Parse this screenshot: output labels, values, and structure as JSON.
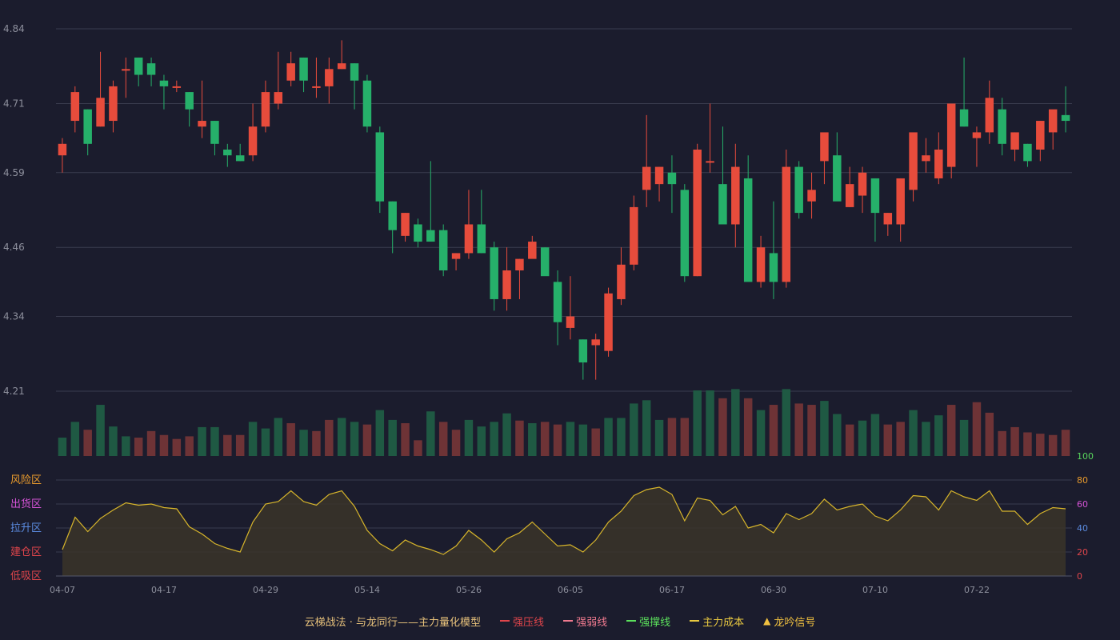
{
  "chart_data": {
    "type": "candlestick",
    "price_axis": {
      "ticks": [
        "4.84",
        "4.71",
        "4.59",
        "4.46",
        "4.34",
        "4.21"
      ],
      "range": [
        4.21,
        4.84
      ]
    },
    "date_ticks": [
      "04-07",
      "04-17",
      "04-29",
      "05-14",
      "05-26",
      "06-05",
      "06-17",
      "06-30",
      "07-10",
      "07-22"
    ],
    "candles": [
      [
        4.62,
        4.65,
        4.59,
        4.64
      ],
      [
        4.68,
        4.74,
        4.66,
        4.73
      ],
      [
        4.7,
        4.7,
        4.62,
        4.64
      ],
      [
        4.67,
        4.8,
        4.67,
        4.72
      ],
      [
        4.68,
        4.75,
        4.66,
        4.74
      ],
      [
        4.77,
        4.79,
        4.72,
        4.77
      ],
      [
        4.79,
        4.79,
        4.74,
        4.76
      ],
      [
        4.78,
        4.79,
        4.74,
        4.76
      ],
      [
        4.75,
        4.76,
        4.7,
        4.74
      ],
      [
        4.74,
        4.75,
        4.73,
        4.74
      ],
      [
        4.73,
        4.73,
        4.67,
        4.7
      ],
      [
        4.67,
        4.75,
        4.65,
        4.68
      ],
      [
        4.68,
        4.68,
        4.62,
        4.64
      ],
      [
        4.63,
        4.64,
        4.6,
        4.62
      ],
      [
        4.62,
        4.64,
        4.61,
        4.61
      ],
      [
        4.62,
        4.71,
        4.61,
        4.67
      ],
      [
        4.67,
        4.75,
        4.66,
        4.73
      ],
      [
        4.71,
        4.8,
        4.7,
        4.73
      ],
      [
        4.75,
        4.8,
        4.74,
        4.78
      ],
      [
        4.79,
        4.79,
        4.73,
        4.75
      ],
      [
        4.74,
        4.79,
        4.72,
        4.74
      ],
      [
        4.74,
        4.79,
        4.71,
        4.77
      ],
      [
        4.77,
        4.82,
        4.77,
        4.78
      ],
      [
        4.78,
        4.78,
        4.7,
        4.75
      ],
      [
        4.75,
        4.76,
        4.66,
        4.67
      ],
      [
        4.66,
        4.67,
        4.52,
        4.54
      ],
      [
        4.54,
        4.54,
        4.45,
        4.49
      ],
      [
        4.48,
        4.52,
        4.47,
        4.52
      ],
      [
        4.5,
        4.51,
        4.46,
        4.47
      ],
      [
        4.49,
        4.61,
        4.48,
        4.47
      ],
      [
        4.49,
        4.5,
        4.41,
        4.42
      ],
      [
        4.44,
        4.45,
        4.42,
        4.45
      ],
      [
        4.45,
        4.56,
        4.44,
        4.5
      ],
      [
        4.5,
        4.56,
        4.45,
        4.45
      ],
      [
        4.46,
        4.47,
        4.35,
        4.37
      ],
      [
        4.37,
        4.46,
        4.35,
        4.42
      ],
      [
        4.42,
        4.44,
        4.37,
        4.44
      ],
      [
        4.44,
        4.48,
        4.45,
        4.47
      ],
      [
        4.46,
        4.46,
        4.42,
        4.41
      ],
      [
        4.4,
        4.42,
        4.29,
        4.33
      ],
      [
        4.32,
        4.41,
        4.3,
        4.34
      ],
      [
        4.3,
        4.3,
        4.23,
        4.26
      ],
      [
        4.29,
        4.31,
        4.23,
        4.3
      ],
      [
        4.28,
        4.39,
        4.27,
        4.38
      ],
      [
        4.37,
        4.46,
        4.36,
        4.43
      ],
      [
        4.43,
        4.55,
        4.42,
        4.53
      ],
      [
        4.56,
        4.69,
        4.53,
        4.6
      ],
      [
        4.57,
        4.6,
        4.54,
        4.6
      ],
      [
        4.59,
        4.62,
        4.52,
        4.57
      ],
      [
        4.56,
        4.57,
        4.4,
        4.41
      ],
      [
        4.41,
        4.64,
        4.41,
        4.63
      ],
      [
        4.61,
        4.71,
        4.59,
        4.61
      ],
      [
        4.57,
        4.67,
        4.52,
        4.5
      ],
      [
        4.5,
        4.64,
        4.46,
        4.6
      ],
      [
        4.58,
        4.62,
        4.42,
        4.4
      ],
      [
        4.4,
        4.48,
        4.39,
        4.46
      ],
      [
        4.45,
        4.54,
        4.37,
        4.4
      ],
      [
        4.4,
        4.63,
        4.39,
        4.6
      ],
      [
        4.6,
        4.61,
        4.51,
        4.52
      ],
      [
        4.54,
        4.59,
        4.51,
        4.56
      ],
      [
        4.61,
        4.64,
        4.57,
        4.66
      ],
      [
        4.62,
        4.66,
        4.55,
        4.54
      ],
      [
        4.53,
        4.6,
        4.53,
        4.57
      ],
      [
        4.55,
        4.6,
        4.52,
        4.59
      ],
      [
        4.58,
        4.58,
        4.47,
        4.52
      ],
      [
        4.5,
        4.52,
        4.48,
        4.52
      ],
      [
        4.5,
        4.58,
        4.47,
        4.58
      ],
      [
        4.56,
        4.65,
        4.54,
        4.66
      ],
      [
        4.61,
        4.65,
        4.59,
        4.62
      ],
      [
        4.58,
        4.66,
        4.57,
        4.63
      ],
      [
        4.6,
        4.7,
        4.58,
        4.71
      ],
      [
        4.7,
        4.79,
        4.67,
        4.67
      ],
      [
        4.65,
        4.67,
        4.6,
        4.66
      ],
      [
        4.66,
        4.75,
        4.64,
        4.72
      ],
      [
        4.7,
        4.72,
        4.62,
        4.64
      ],
      [
        4.63,
        4.66,
        4.61,
        4.66
      ],
      [
        4.64,
        4.64,
        4.6,
        4.61
      ],
      [
        4.63,
        4.68,
        4.61,
        4.68
      ],
      [
        4.66,
        4.69,
        4.63,
        4.7
      ],
      [
        4.69,
        4.74,
        4.66,
        4.68
      ]
    ],
    "volume_levels": [
      28,
      52,
      40,
      78,
      45,
      30,
      28,
      38,
      32,
      26,
      30,
      44,
      44,
      32,
      32,
      52,
      42,
      58,
      50,
      40,
      38,
      55,
      58,
      52,
      48,
      70,
      55,
      50,
      24,
      68,
      52,
      40,
      55,
      45,
      52,
      65,
      54,
      50,
      52,
      48,
      52,
      48,
      42,
      58,
      58,
      80,
      85,
      55,
      58,
      58,
      100,
      100,
      88,
      102,
      88,
      70,
      78,
      102,
      80,
      78,
      84,
      64,
      48,
      54,
      64,
      48,
      52,
      70,
      52,
      62,
      78,
      55,
      82,
      66,
      38,
      44,
      36,
      34,
      32,
      40,
      44,
      40
    ],
    "volume_up": [
      false,
      false,
      true,
      false,
      false,
      false,
      true,
      true,
      true,
      true,
      true,
      false,
      false,
      true,
      true,
      false,
      false,
      false,
      true,
      false,
      true,
      true,
      false,
      false,
      true,
      false,
      false,
      true,
      true,
      false,
      true,
      true,
      false,
      false,
      false,
      false,
      true,
      false,
      true,
      true,
      false,
      false,
      true,
      false,
      false,
      false,
      false,
      false,
      true,
      true,
      false,
      false,
      true,
      false,
      true,
      false,
      true,
      false,
      true,
      true,
      false,
      false,
      true,
      false,
      false,
      true,
      true,
      false,
      false,
      false,
      true,
      false,
      true,
      true,
      true,
      true,
      true,
      true,
      true,
      true,
      true,
      true
    ],
    "indicator": {
      "zone_labels": [
        "风险区",
        "出货区",
        "拉升区",
        "建仓区",
        "低吸区"
      ],
      "zone_colors": [
        "#e89a2d",
        "#d553d6",
        "#5b8be0",
        "#e0454b",
        "#e0454b"
      ],
      "right_ticks": [
        "100",
        "80",
        "60",
        "40",
        "20",
        "0"
      ],
      "right_tick_colors": [
        "#58d65c",
        "#e89a2d",
        "#d553d6",
        "#5b8be0",
        "#e0454b",
        "#e0454b"
      ],
      "range": [
        0,
        100
      ],
      "values": [
        22,
        49,
        37,
        48,
        55,
        61,
        59,
        60,
        57,
        56,
        41,
        35,
        27,
        23,
        20,
        45,
        60,
        62,
        71,
        62,
        59,
        68,
        71,
        58,
        38,
        27,
        21,
        30,
        25,
        22,
        18,
        25,
        38,
        30,
        20,
        31,
        36,
        45,
        35,
        25,
        26,
        20,
        30,
        45,
        54,
        67,
        72,
        74,
        68,
        46,
        65,
        63,
        51,
        58,
        40,
        43,
        36,
        52,
        47,
        52,
        64,
        55,
        58,
        60,
        50,
        46,
        55,
        67,
        66,
        55,
        71,
        66,
        63,
        71,
        54,
        54,
        43,
        52,
        57,
        56
      ]
    },
    "legend": [
      {
        "label": "云梯战法 · 与龙同行——主力量化模型",
        "marker": "none",
        "color": "#e6c07a"
      },
      {
        "label": "强压线",
        "marker": "line",
        "color": "#e0454b"
      },
      {
        "label": "强弱线",
        "marker": "dash",
        "color": "#f07a8f"
      },
      {
        "label": "强撑线",
        "marker": "line",
        "color": "#5be05c"
      },
      {
        "label": "主力成本",
        "marker": "dash",
        "color": "#e8c840"
      },
      {
        "label": "龙吟信号",
        "marker": "triangle",
        "color": "#f0c040"
      }
    ],
    "colors": {
      "up": "#e74c3c",
      "down": "#26b06a",
      "vol_up": "#6e3336",
      "vol_down": "#1f5943",
      "grid": "#3a3c4e",
      "axis_text": "#8d8f9c",
      "indicator_line": "#d7b52b",
      "indicator_fill": "#3a3429"
    }
  }
}
